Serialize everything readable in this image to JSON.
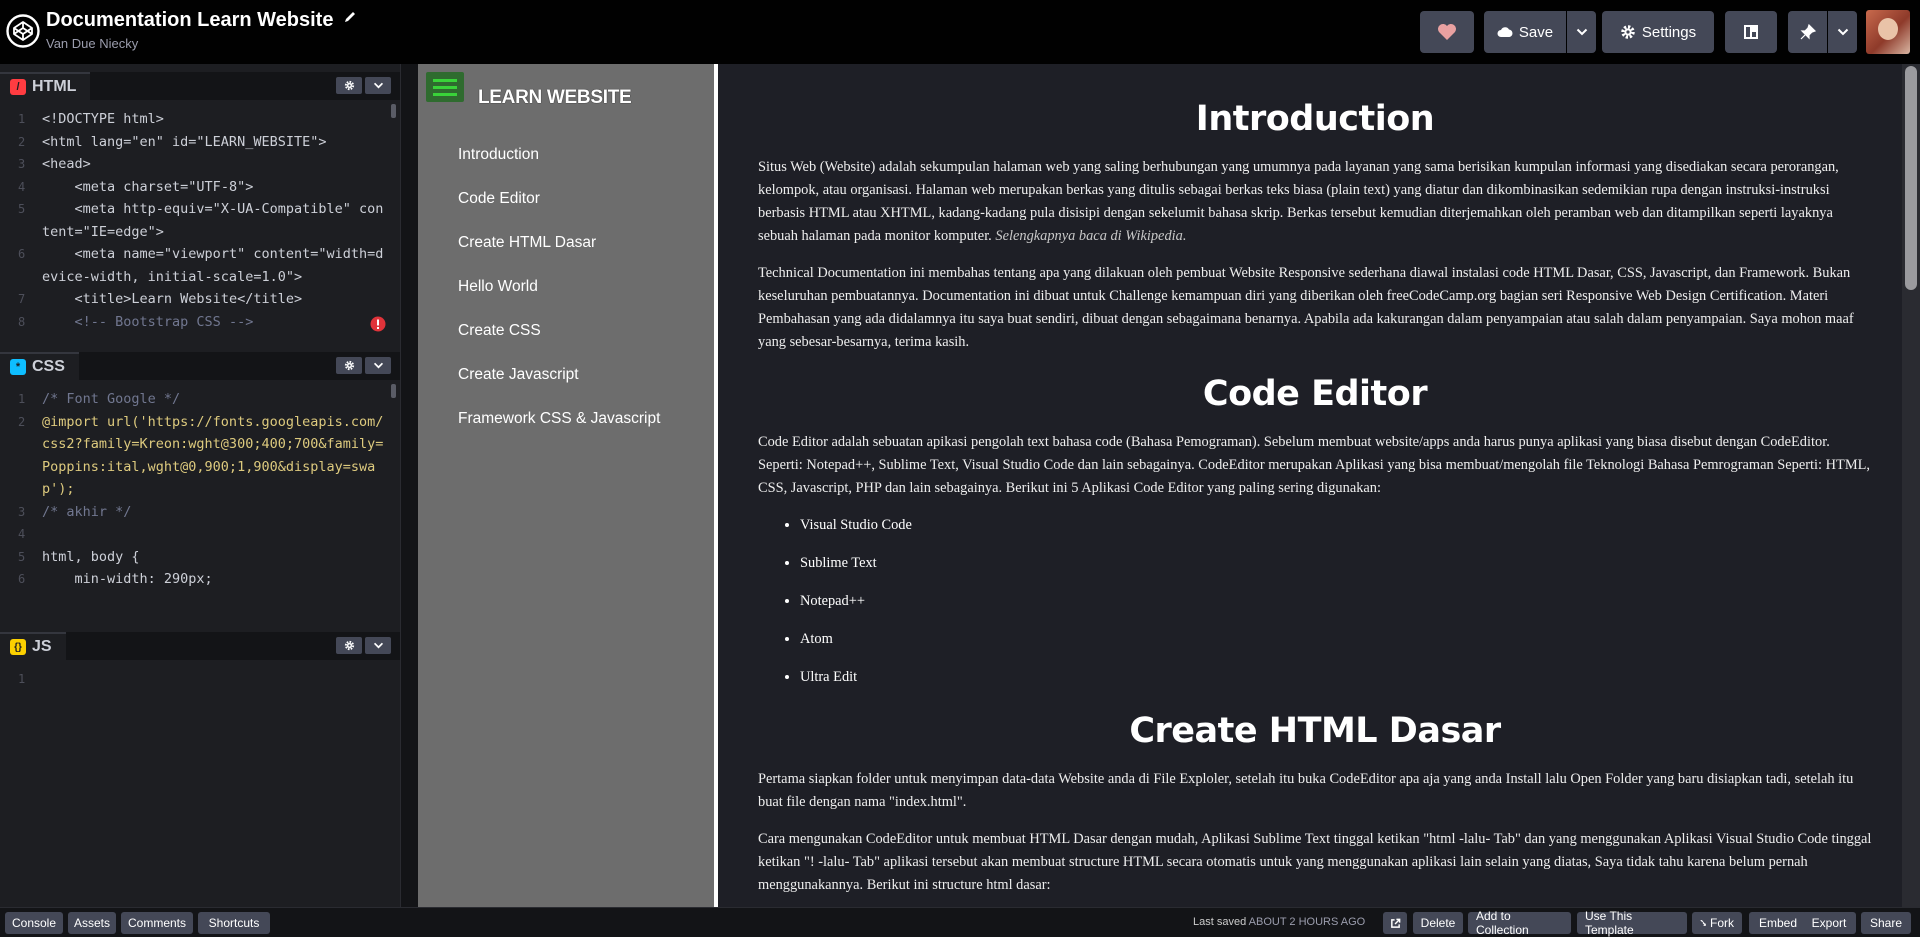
{
  "header": {
    "title": "Documentation Learn Website",
    "author": "Van Due Niecky",
    "save_label": "Save",
    "settings_label": "Settings"
  },
  "editors": {
    "html": {
      "label": "HTML",
      "badge": "/",
      "lines": [
        {
          "n": "1",
          "t": "<!DOCTYPE html>"
        },
        {
          "n": "2",
          "t": "<html lang=\"en\" id=\"LEARN_WEBSITE\">"
        },
        {
          "n": "3",
          "t": "<head>"
        },
        {
          "n": "4",
          "t": "    <meta charset=\"UTF-8\">"
        },
        {
          "n": "5",
          "t": "    <meta http-equiv=\"X-UA-Compatible\" content=\"IE=edge\">"
        },
        {
          "n": "6",
          "t": "    <meta name=\"viewport\" content=\"width=device-width, initial-scale=1.0\">"
        },
        {
          "n": "7",
          "t": "    <title>Learn Website</title>"
        },
        {
          "n": "8",
          "t": "    <!-- Bootstrap CSS -->"
        }
      ]
    },
    "css": {
      "label": "CSS",
      "badge": "*",
      "lines": [
        {
          "n": "1",
          "t": "/* Font Google */"
        },
        {
          "n": "2",
          "t": "@import url('https://fonts.googleapis.com/css2?family=Kreon:wght@300;400;700&family=Poppins:ital,wght@0,900;1,900&display=swap');"
        },
        {
          "n": "3",
          "t": "/* akhir */"
        },
        {
          "n": "4",
          "t": ""
        },
        {
          "n": "5",
          "t": "html, body {"
        },
        {
          "n": "6",
          "t": "    min-width: 290px;"
        }
      ]
    },
    "js": {
      "label": "JS",
      "badge": "{}",
      "lines": [
        {
          "n": "1",
          "t": ""
        }
      ]
    }
  },
  "preview": {
    "brand": "LEARN WEBSITE",
    "nav": [
      "Introduction",
      "Code Editor",
      "Create HTML Dasar",
      "Hello World",
      "Create CSS",
      "Create Javascript",
      "Framework CSS & Javascript"
    ],
    "sections": {
      "intro_title": "Introduction",
      "intro_p1": "Situs Web (Website) adalah sekumpulan halaman web yang saling berhubungan yang umumnya pada layanan yang sama berisikan kumpulan informasi yang disediakan secara perorangan, kelompok, atau organisasi. Halaman web merupakan berkas yang ditulis sebagai berkas teks biasa (plain text) yang diatur dan dikombinasikan sedemikian rupa dengan instruksi-instruksi berbasis HTML atau XHTML, kadang-kadang pula disisipi dengan sekelumit bahasa skrip. Berkas tersebut kemudian diterjemahkan oleh peramban web dan ditampilkan seperti layaknya sebuah halaman pada monitor komputer.",
      "intro_p1_em": "Selengkapnya baca di Wikipedia.",
      "intro_p2": "Technical Documentation ini membahas tentang apa yang dilakuan oleh pembuat Website Responsive sederhana diawal instalasi code HTML Dasar, CSS, Javascript, dan Framework. Bukan keseluruhan pembuatannya. Documentation ini dibuat untuk Challenge kemampuan diri yang diberikan oleh freeCodeCamp.org bagian seri Responsive Web Design Certification. Materi Pembahasan yang ada didalamnya itu saya buat sendiri, dibuat dengan sebagaimana benarnya. Apabila ada kakurangan dalam penyampaian atau salah dalam penyampaian. Saya mohon maaf yang sebesar-besarnya, terima kasih.",
      "editor_title": "Code Editor",
      "editor_p1": "Code Editor adalah sebuatan apikasi pengolah text bahasa code (Bahasa Pemograman). Sebelum membuat website/apps anda harus punya aplikasi yang biasa disebut dengan CodeEditor. Seperti: Notepad++, Sublime Text, Visual Studio Code dan lain sebagainya. CodeEditor merupakan Aplikasi yang bisa membuat/mengolah file Teknologi Bahasa Pemrograman Seperti: HTML, CSS, Javascript, PHP dan lain sebagainya. Berikut ini 5 Aplikasi Code Editor yang paling sering digunakan:",
      "editor_list": [
        "Visual Studio Code",
        "Sublime Text",
        "Notepad++",
        "Atom",
        "Ultra Edit"
      ],
      "html_title": "Create HTML Dasar",
      "html_p1": "Pertama siapkan folder untuk menyimpan data-data Website anda di File Exploler, setelah itu buka CodeEditor apa aja yang anda Install lalu Open Folder yang baru disiapkan tadi, setelah itu buat file dengan nama \"index.html\".",
      "html_p2": "Cara mengunakan CodeEditor untuk membuat HTML Dasar dengan mudah, Aplikasi Sublime Text tinggal ketikan \"html -lalu- Tab\" dan yang menggunakan Aplikasi Visual Studio Code tinggal ketikan \"! -lalu- Tab\" aplikasi tersebut akan membuat structure HTML secara otomatis untuk yang menggunakan aplikasi lain selain yang diatas, Saya tidak tahu karena belum pernah menggunakannya. Berikut ini structure html dasar:"
    }
  },
  "footer": {
    "console": "Console",
    "assets": "Assets",
    "comments": "Comments",
    "shortcuts": "Shortcuts",
    "last_saved_label": "Last saved",
    "last_saved_value": "ABOUT 2 HOURS AGO",
    "delete": "Delete",
    "add_to_collection": "Add to Collection",
    "use_template": "Use This Template",
    "fork": "Fork",
    "embed": "Embed",
    "export": "Export",
    "share": "Share"
  },
  "colors": {
    "header_bg": "#010101",
    "button_bg": "#444857",
    "sidebar_bg": "#6d6d6d",
    "preview_bg": "#1e1f26",
    "burger_green": "#39d339"
  }
}
